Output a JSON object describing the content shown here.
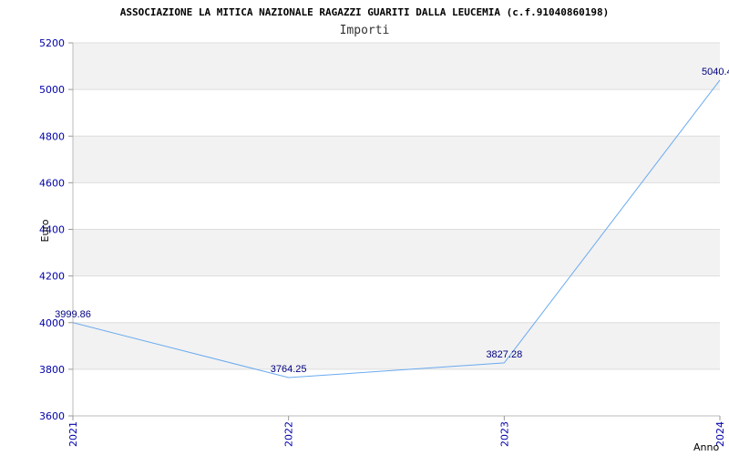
{
  "chart_data": {
    "type": "line",
    "title": "ASSOCIAZIONE LA MITICA NAZIONALE RAGAZZI GUARITI DALLA LEUCEMIA (c.f.91040860198)",
    "subtitle": "Importi",
    "xlabel": "Anno",
    "ylabel": "Euro",
    "categories": [
      "2021",
      "2022",
      "2023",
      "2024"
    ],
    "values": [
      3999.86,
      3764.25,
      3827.28,
      5040.4
    ],
    "value_labels": [
      "3999.86",
      "3764.25",
      "3827.28",
      "5040.4"
    ],
    "ylim": [
      3600,
      5200
    ],
    "yticks": [
      "3600",
      "3800",
      "4000",
      "4200",
      "4400",
      "4600",
      "4800",
      "5000",
      "5200"
    ],
    "grid": true,
    "line_color": "#6aaaf0",
    "band_color": "#f2f2f2",
    "grid_color": "#dddddd",
    "tick_color": "#0000aa",
    "label_color": "#000080"
  }
}
